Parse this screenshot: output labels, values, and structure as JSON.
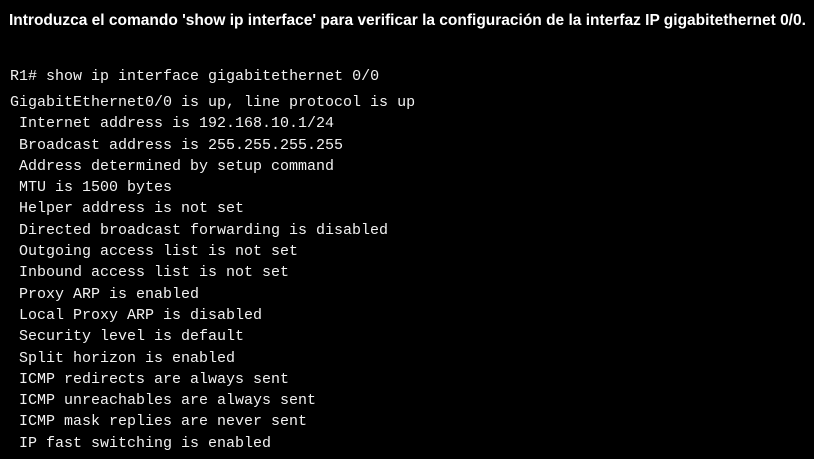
{
  "instruction": {
    "text": "Introduzca el comando 'show ip interface' para verificar la configuración de la interfaz IP gigabitethernet 0/0."
  },
  "terminal": {
    "prompt": "R1#",
    "command": "show ip interface gigabitethernet 0/0",
    "output": [
      "GigabitEthernet0/0 is up, line protocol is up",
      " Internet address is 192.168.10.1/24",
      " Broadcast address is 255.255.255.255",
      " Address determined by setup command",
      " MTU is 1500 bytes",
      " Helper address is not set",
      " Directed broadcast forwarding is disabled",
      " Outgoing access list is not set",
      " Inbound access list is not set",
      " Proxy ARP is enabled",
      " Local Proxy ARP is disabled",
      " Security level is default",
      " Split horizon is enabled",
      " ICMP redirects are always sent",
      " ICMP unreachables are always sent",
      " ICMP mask replies are never sent",
      " IP fast switching is enabled"
    ]
  },
  "colors": {
    "background": "#000000",
    "text": "#ffffff"
  }
}
